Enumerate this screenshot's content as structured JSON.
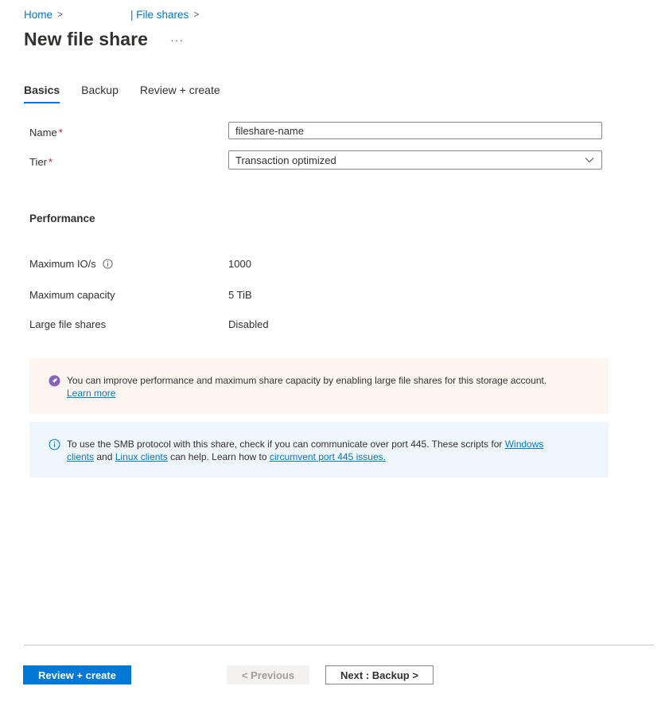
{
  "breadcrumb": {
    "home": "Home",
    "file_shares": "| File shares",
    "separator": ">"
  },
  "header": {
    "title": "New file share",
    "more": "···"
  },
  "tabs": [
    {
      "label": "Basics",
      "active": true
    },
    {
      "label": "Backup",
      "active": false
    },
    {
      "label": "Review + create",
      "active": false
    }
  ],
  "form": {
    "name_label": "Name",
    "name_value": "fileshare-name",
    "tier_label": "Tier",
    "tier_value": "Transaction optimized",
    "required_mark": "*"
  },
  "performance": {
    "title": "Performance",
    "rows": [
      {
        "label": "Maximum IO/s",
        "value": "1000"
      },
      {
        "label": "Maximum capacity",
        "value": "5 TiB"
      },
      {
        "label": "Large file shares",
        "value": "Disabled"
      }
    ]
  },
  "banners": {
    "upgrade": {
      "text": "You can improve performance and maximum share capacity by enabling large file shares for this storage account.",
      "link": "Learn more"
    },
    "smb": {
      "text_1": "To use the SMB protocol with this share, check if you can communicate over port 445. These scripts for",
      "link_1": "Windows clients",
      "text_2": "and",
      "link_2": "Linux clients",
      "text_3": "can help. Learn how to",
      "link_3": "circumvent port 445 issues."
    }
  },
  "footer": {
    "review_create": "Review + create",
    "previous": "< Previous",
    "next": "Next : Backup >"
  },
  "colors": {
    "accent": "#0078d4",
    "upgrade_icon": "#8764b8",
    "upgrade_bg": "#fdf6f0",
    "info_bg": "#eff6fc"
  }
}
